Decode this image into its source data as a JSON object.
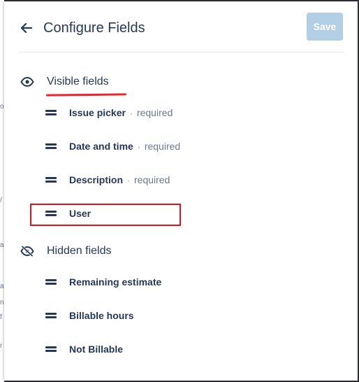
{
  "header": {
    "title": "Configure Fields",
    "save_label": "Save"
  },
  "visible_section": {
    "label": "Visible fields",
    "fields": [
      {
        "name": "Issue picker",
        "dot": "·",
        "note": "required"
      },
      {
        "name": "Date and time",
        "dot": "·",
        "note": "required"
      },
      {
        "name": "Description",
        "dot": "·",
        "note": "required"
      },
      {
        "name": "User"
      }
    ]
  },
  "hidden_section": {
    "label": "Hidden fields",
    "fields": [
      {
        "name": "Remaining estimate"
      },
      {
        "name": "Billable hours"
      },
      {
        "name": "Not Billable"
      }
    ]
  },
  "background_glyphs": [
    "o",
    "/",
    "a",
    "a",
    "n",
    "f",
    "r"
  ],
  "colors": {
    "accent_red": "#e0121a",
    "text_primary": "#253858",
    "text_secondary": "#6b778c",
    "save_disabled": "#b3cfe5"
  },
  "icons": {
    "back": "arrow-left-icon",
    "visible": "eye-icon",
    "hidden": "eye-slash-icon",
    "drag": "drag-handle-icon"
  }
}
